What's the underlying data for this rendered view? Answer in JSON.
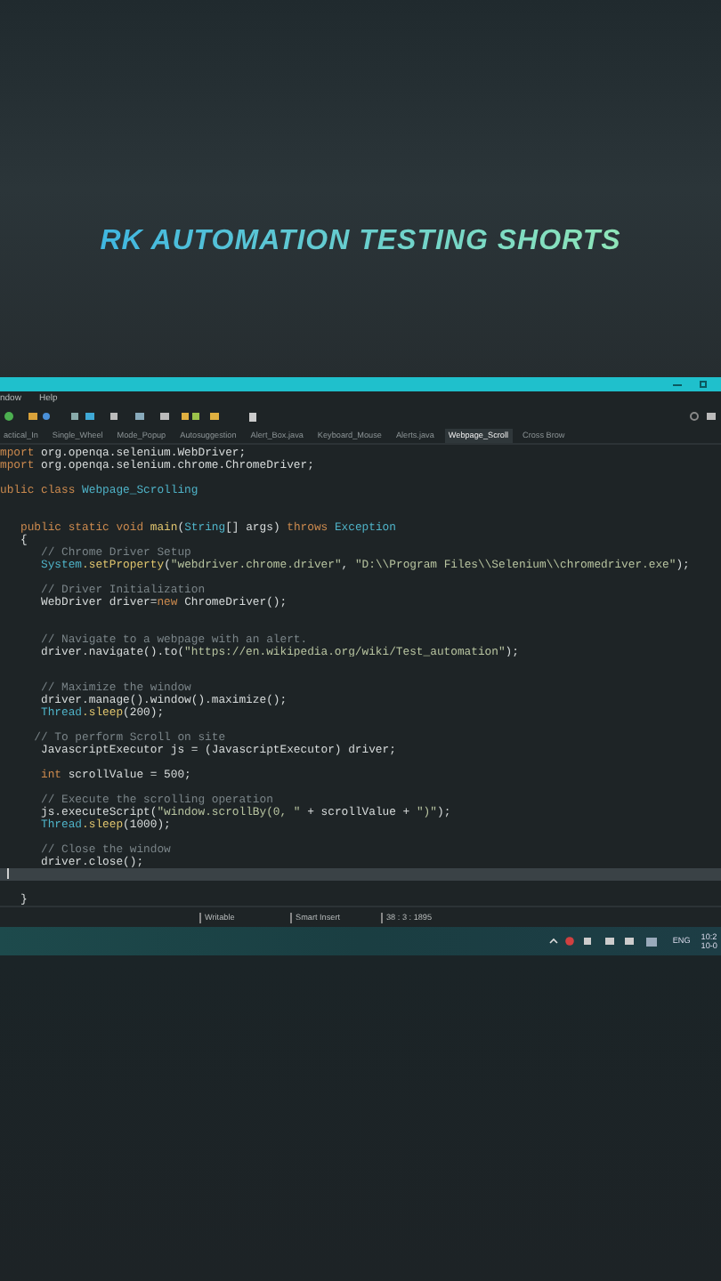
{
  "title": "RK AUTOMATION TESTING SHORTS",
  "menu": [
    "ndow",
    "Help"
  ],
  "tabs": [
    {
      "label": "actical_In",
      "selected": false
    },
    {
      "label": "Single_Wheel",
      "selected": false
    },
    {
      "label": "Mode_Popup",
      "selected": false
    },
    {
      "label": "Autosuggestion",
      "selected": false
    },
    {
      "label": "Alert_Box.java",
      "selected": false
    },
    {
      "label": "Keyboard_Mouse",
      "selected": false
    },
    {
      "label": "Alerts.java",
      "selected": false
    },
    {
      "label": "Webpage_Scroll",
      "selected": true
    },
    {
      "label": "Cross Brow",
      "selected": false
    }
  ],
  "code_lines": [
    {
      "kind": "code",
      "current": false,
      "tokens": [
        {
          "kind": "kw",
          "text": "mport"
        },
        {
          "kind": "plain",
          "text": " org.openqa.selenium.WebDriver;"
        }
      ]
    },
    {
      "kind": "code",
      "current": false,
      "tokens": [
        {
          "kind": "kw",
          "text": "mport"
        },
        {
          "kind": "plain",
          "text": " org.openqa.selenium.chrome.ChromeDriver;"
        }
      ]
    },
    {
      "kind": "blank",
      "current": false
    },
    {
      "kind": "code",
      "current": false,
      "tokens": [
        {
          "kind": "kw",
          "text": "ublic class"
        },
        {
          "kind": "type",
          "text": " Webpage_Scrolling"
        }
      ]
    },
    {
      "kind": "blank",
      "current": false
    },
    {
      "kind": "blank",
      "current": false
    },
    {
      "kind": "code",
      "current": false,
      "tokens": [
        {
          "kind": "kw",
          "text": "   public static void"
        },
        {
          "kind": "fn",
          "text": " main"
        },
        {
          "kind": "plain",
          "text": "("
        },
        {
          "kind": "type",
          "text": "String"
        },
        {
          "kind": "plain",
          "text": "[] args) "
        },
        {
          "kind": "kw",
          "text": "throws"
        },
        {
          "kind": "type",
          "text": " Exception"
        }
      ]
    },
    {
      "kind": "code",
      "current": false,
      "tokens": [
        {
          "kind": "plain",
          "text": "   {"
        }
      ]
    },
    {
      "kind": "code",
      "current": false,
      "tokens": [
        {
          "kind": "cm",
          "text": "      // Chrome Driver Setup"
        }
      ]
    },
    {
      "kind": "code",
      "current": false,
      "tokens": [
        {
          "kind": "type",
          "text": "      System"
        },
        {
          "kind": "fn",
          "text": ".setProperty"
        },
        {
          "kind": "plain",
          "text": "("
        },
        {
          "kind": "str",
          "text": "\"webdriver.chrome.driver\""
        },
        {
          "kind": "plain",
          "text": ", "
        },
        {
          "kind": "str",
          "text": "\"D:\\\\Program Files\\\\Selenium\\\\chromedriver.exe\""
        },
        {
          "kind": "plain",
          "text": ");"
        }
      ]
    },
    {
      "kind": "blank",
      "current": false
    },
    {
      "kind": "code",
      "current": false,
      "tokens": [
        {
          "kind": "cm",
          "text": "      // Driver Initialization"
        }
      ]
    },
    {
      "kind": "code",
      "current": false,
      "tokens": [
        {
          "kind": "plain",
          "text": "      WebDriver driver="
        },
        {
          "kind": "kw",
          "text": "new"
        },
        {
          "kind": "plain",
          "text": " ChromeDriver();"
        }
      ]
    },
    {
      "kind": "blank",
      "current": false
    },
    {
      "kind": "blank",
      "current": false
    },
    {
      "kind": "code",
      "current": false,
      "tokens": [
        {
          "kind": "cm",
          "text": "      // Navigate to a webpage with an alert."
        }
      ]
    },
    {
      "kind": "code",
      "current": false,
      "tokens": [
        {
          "kind": "plain",
          "text": "      driver.navigate().to("
        },
        {
          "kind": "str",
          "text": "\"https://en.wikipedia.org/wiki/Test_automation\""
        },
        {
          "kind": "plain",
          "text": ");"
        }
      ]
    },
    {
      "kind": "blank",
      "current": false
    },
    {
      "kind": "blank",
      "current": false
    },
    {
      "kind": "code",
      "current": false,
      "tokens": [
        {
          "kind": "cm",
          "text": "      // Maximize the window"
        }
      ]
    },
    {
      "kind": "code",
      "current": false,
      "tokens": [
        {
          "kind": "plain",
          "text": "      driver.manage().window().maximize();"
        }
      ]
    },
    {
      "kind": "code",
      "current": false,
      "tokens": [
        {
          "kind": "type",
          "text": "      Thread"
        },
        {
          "kind": "fn",
          "text": ".sleep"
        },
        {
          "kind": "plain",
          "text": "(200);"
        }
      ]
    },
    {
      "kind": "blank",
      "current": false
    },
    {
      "kind": "code",
      "current": false,
      "tokens": [
        {
          "kind": "cm",
          "text": "     // To perform Scroll on site"
        }
      ]
    },
    {
      "kind": "code",
      "current": false,
      "tokens": [
        {
          "kind": "plain",
          "text": "      JavascriptExecutor js = (JavascriptExecutor) driver;"
        }
      ]
    },
    {
      "kind": "blank",
      "current": false
    },
    {
      "kind": "code",
      "current": false,
      "tokens": [
        {
          "kind": "kw",
          "text": "      int"
        },
        {
          "kind": "plain",
          "text": " scrollValue = 500;"
        }
      ]
    },
    {
      "kind": "blank",
      "current": false
    },
    {
      "kind": "code",
      "current": false,
      "tokens": [
        {
          "kind": "cm",
          "text": "      // Execute the scrolling operation"
        }
      ]
    },
    {
      "kind": "code",
      "current": false,
      "tokens": [
        {
          "kind": "plain",
          "text": "      js.executeScript("
        },
        {
          "kind": "str",
          "text": "\"window.scrollBy(0, \""
        },
        {
          "kind": "plain",
          "text": " + scrollValue + "
        },
        {
          "kind": "str",
          "text": "\")\""
        },
        {
          "kind": "plain",
          "text": ");"
        }
      ]
    },
    {
      "kind": "code",
      "current": false,
      "tokens": [
        {
          "kind": "type",
          "text": "      Thread"
        },
        {
          "kind": "fn",
          "text": ".sleep"
        },
        {
          "kind": "plain",
          "text": "(1000);"
        }
      ]
    },
    {
      "kind": "blank",
      "current": false
    },
    {
      "kind": "code",
      "current": false,
      "tokens": [
        {
          "kind": "cm",
          "text": "      // Close the window"
        }
      ]
    },
    {
      "kind": "code",
      "current": false,
      "tokens": [
        {
          "kind": "plain",
          "text": "      driver.close();"
        }
      ]
    },
    {
      "kind": "blank",
      "current": true
    },
    {
      "kind": "blank",
      "current": false
    },
    {
      "kind": "code",
      "current": false,
      "tokens": [
        {
          "kind": "plain",
          "text": "   }"
        }
      ]
    }
  ],
  "status_bar": [
    "Writable",
    "Smart Insert",
    "38 : 3 : 1895"
  ],
  "taskbar": {
    "language": "ENG",
    "time": "10:2",
    "date": "10-0"
  }
}
